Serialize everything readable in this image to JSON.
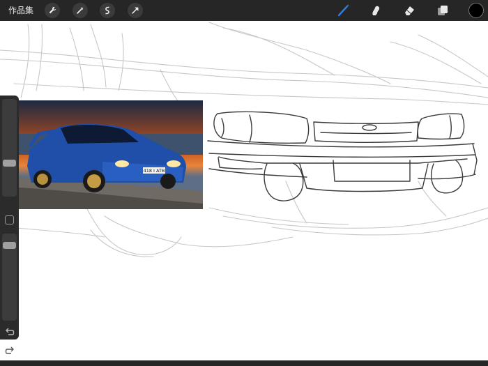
{
  "app": {
    "gallery_label": "作品集"
  },
  "top_tools_left": [
    {
      "name": "wrench-icon"
    },
    {
      "name": "magic-wand-icon"
    },
    {
      "name": "selection-s-icon"
    },
    {
      "name": "transform-arrow-icon"
    }
  ],
  "top_tools_right": [
    {
      "name": "brush-icon",
      "active": true,
      "color": "#2f7fe0"
    },
    {
      "name": "smudge-icon"
    },
    {
      "name": "eraser-icon"
    },
    {
      "name": "layers-icon"
    }
  ],
  "current_color": "#000000",
  "sidebar": {
    "brush_size": 0.33,
    "opacity": 0.9,
    "icons": [
      "modify-square-icon",
      "undo-icon",
      "redo-icon"
    ]
  },
  "reference_image": {
    "plate_text": "418 I ATB"
  }
}
